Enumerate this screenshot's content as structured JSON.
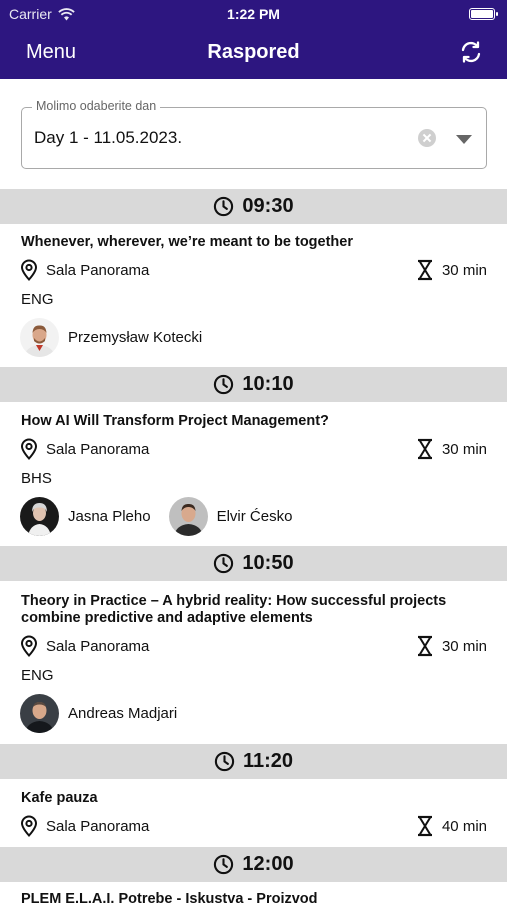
{
  "status_bar": {
    "carrier": "Carrier",
    "time": "1:22 PM"
  },
  "nav": {
    "menu": "Menu",
    "title": "Raspored"
  },
  "day_picker": {
    "label": "Molimo odaberite dan",
    "value": "Day 1 - 11.05.2023."
  },
  "slots": [
    {
      "time": "09:30",
      "sessions": [
        {
          "title": "Whenever, wherever, we’re meant to be together",
          "room": "Sala Panorama",
          "duration": "30 min",
          "lang": "ENG",
          "speakers": [
            {
              "name": "Przemysław Kotecki"
            }
          ]
        }
      ]
    },
    {
      "time": "10:10",
      "sessions": [
        {
          "title": "How AI Will Transform Project Management?",
          "room": "Sala Panorama",
          "duration": "30 min",
          "lang": "BHS",
          "speakers": [
            {
              "name": "Jasna Pleho"
            },
            {
              "name": "Elvir Ćesko"
            }
          ]
        }
      ]
    },
    {
      "time": "10:50",
      "sessions": [
        {
          "title": "Theory in Practice – A hybrid reality: How successful projects combine predictive and adaptive elements",
          "room": "Sala Panorama",
          "duration": "30 min",
          "lang": "ENG",
          "speakers": [
            {
              "name": "Andreas Madjari"
            }
          ]
        }
      ]
    },
    {
      "time": "11:20",
      "sessions": [
        {
          "title": "Kafe pauza",
          "room": "Sala Panorama",
          "duration": "40 min"
        }
      ]
    },
    {
      "time": "12:00",
      "sessions": [
        {
          "title": "PLEM E.L.A.I. Potrebe - Iskustva - Proizvod"
        }
      ]
    }
  ],
  "colors": {
    "header_bg": "#2d1680",
    "slot_header_bg": "#d9d9d9"
  },
  "icons": {
    "clock": "clock-icon",
    "location": "location-pin-icon",
    "duration": "hourglass-icon",
    "refresh": "refresh-icon",
    "wifi": "wifi-icon"
  }
}
